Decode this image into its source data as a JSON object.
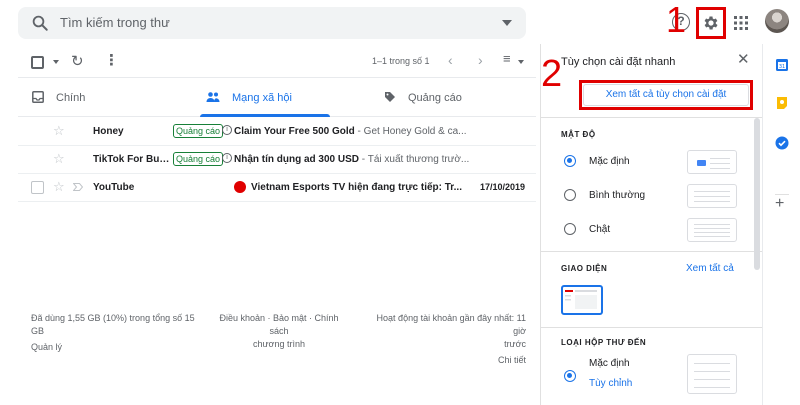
{
  "header": {
    "search_placeholder": "Tìm kiếm trong thư",
    "help_symbol": "?"
  },
  "annotations": {
    "step1": "1",
    "step2": "2"
  },
  "toolbar": {
    "count": "1–1 trong số 1"
  },
  "tabs": [
    {
      "label": "Chính",
      "active": false
    },
    {
      "label": "Mạng xã hội",
      "active": true
    },
    {
      "label": "Quảng cáo",
      "active": false
    }
  ],
  "emails": [
    {
      "sender": "Honey",
      "badge": "Quảng cáo",
      "subject": "Claim Your Free 500 Gold",
      "snippet": " - Get Honey Gold & ca...",
      "date": ""
    },
    {
      "sender": "TikTok For Bus...",
      "badge": "Quảng cáo",
      "subject": "Nhận tín dụng ad 300 USD",
      "snippet": " - Tái xuất thương trườ...",
      "date": ""
    },
    {
      "sender": "YouTube",
      "badge": "",
      "subject": "Vietnam Esports TV hiện đang trực tiếp: Tr...",
      "snippet": "",
      "date": "17/10/2019"
    }
  ],
  "footer": {
    "storage_line1": "Đã dùng 1,55 GB (10%) trong tổng số 15",
    "storage_line2": "GB",
    "manage": "Quản lý",
    "terms_line1": "Điều khoản · Bảo mật · Chính sách",
    "terms_line2": "chương trình",
    "activity_line1": "Hoạt động tài khoản gần đây nhất: 11 giờ",
    "activity_line2": "trước",
    "details": "Chi tiết"
  },
  "quick_settings": {
    "title": "Tùy chọn cài đặt nhanh",
    "see_all_settings": "Xem tất cả tùy chọn cài đặt",
    "density_title": "MẬT ĐỘ",
    "density_options": [
      {
        "label": "Mặc định",
        "selected": true
      },
      {
        "label": "Bình thường",
        "selected": false
      },
      {
        "label": "Chật",
        "selected": false
      }
    ],
    "theme_title": "GIAO DIỆN",
    "theme_see_all": "Xem tất cả",
    "inbox_title": "LOẠI HỘP THƯ ĐẾN",
    "inbox_default": "Mặc định",
    "inbox_customize": "Tùy chỉnh"
  },
  "colors": {
    "accent": "#1a73e8",
    "annotation_red": "#e00000",
    "promo_green": "#188038"
  }
}
